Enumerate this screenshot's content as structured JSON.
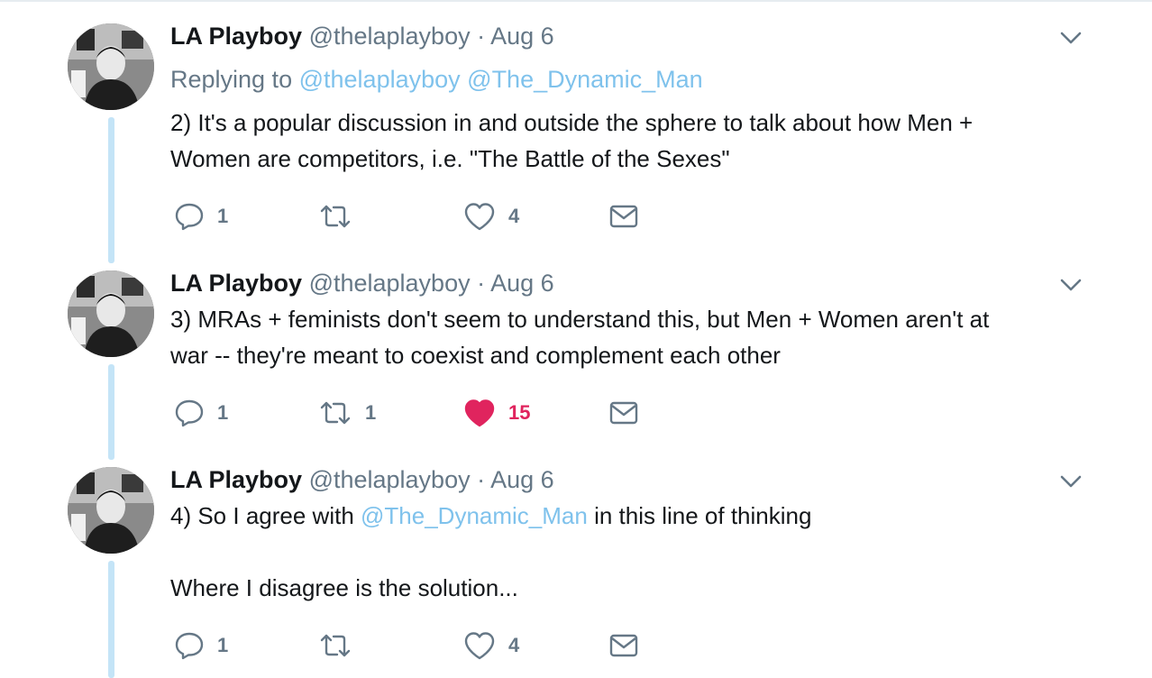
{
  "tweets": [
    {
      "name": "LA Playboy",
      "handle": "@thelaplayboy",
      "separator": "·",
      "time": "Aug 6",
      "replying_label": "Replying to",
      "replying_mentions": [
        "@thelaplayboy",
        "@The_Dynamic_Man"
      ],
      "text_lines": [
        "2) It's a popular discussion in and outside the sphere to talk about how Men +",
        "Women are competitors, i.e. \"The Battle of the Sexes\""
      ],
      "reply_count": "1",
      "retweet_count": "",
      "like_count": "4",
      "liked": false
    },
    {
      "name": "LA Playboy",
      "handle": "@thelaplayboy",
      "separator": "·",
      "time": "Aug 6",
      "text_lines": [
        "3) MRAs + feminists don't seem to understand this, but Men + Women aren't at",
        "war -- they're meant to coexist and complement each other"
      ],
      "reply_count": "1",
      "retweet_count": "1",
      "like_count": "15",
      "liked": true
    },
    {
      "name": "LA Playboy",
      "handle": "@thelaplayboy",
      "separator": "·",
      "time": "Aug 6",
      "text_prefix": "4) So I agree with",
      "text_mention": "@The_Dynamic_Man",
      "text_suffix": "in this line of thinking",
      "text_line2": "Where I disagree is the solution...",
      "reply_count": "1",
      "retweet_count": "",
      "like_count": "4",
      "liked": false
    }
  ],
  "icons": {
    "reply": "reply-icon",
    "retweet": "retweet-icon",
    "like": "heart-icon",
    "dm": "envelope-icon",
    "caret": "chevron-down-icon"
  },
  "colors": {
    "text": "#14171a",
    "muted": "#657786",
    "mention": "#7fc2ec",
    "thread_line": "#c4e4f7",
    "liked": "#e0245e"
  }
}
